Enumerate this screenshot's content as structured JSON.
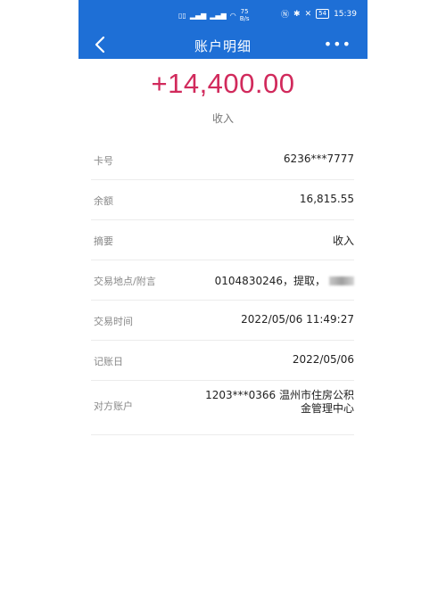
{
  "status_bar": {
    "net_speed": "75",
    "net_speed_unit": "B/s",
    "battery": "54",
    "time": "15:39"
  },
  "header": {
    "title": "账户明细"
  },
  "transaction": {
    "amount": "+14,400.00",
    "type": "收入"
  },
  "details": [
    {
      "label": "卡号",
      "value": "6236***7777"
    },
    {
      "label": "余额",
      "value": "16,815.55"
    },
    {
      "label": "摘要",
      "value": "收入"
    },
    {
      "label": "交易地点/附言",
      "value": "0104830246，提取，"
    },
    {
      "label": "交易时间",
      "value": "2022/05/06 11:49:27"
    },
    {
      "label": "记账日",
      "value": "2022/05/06"
    },
    {
      "label": "对方账户",
      "value_line1": "1203***0366 温州市住房公积",
      "value_line2": "金管理中心"
    }
  ],
  "colors": {
    "primary": "#1e6fd6",
    "amount": "#d12a5c"
  }
}
